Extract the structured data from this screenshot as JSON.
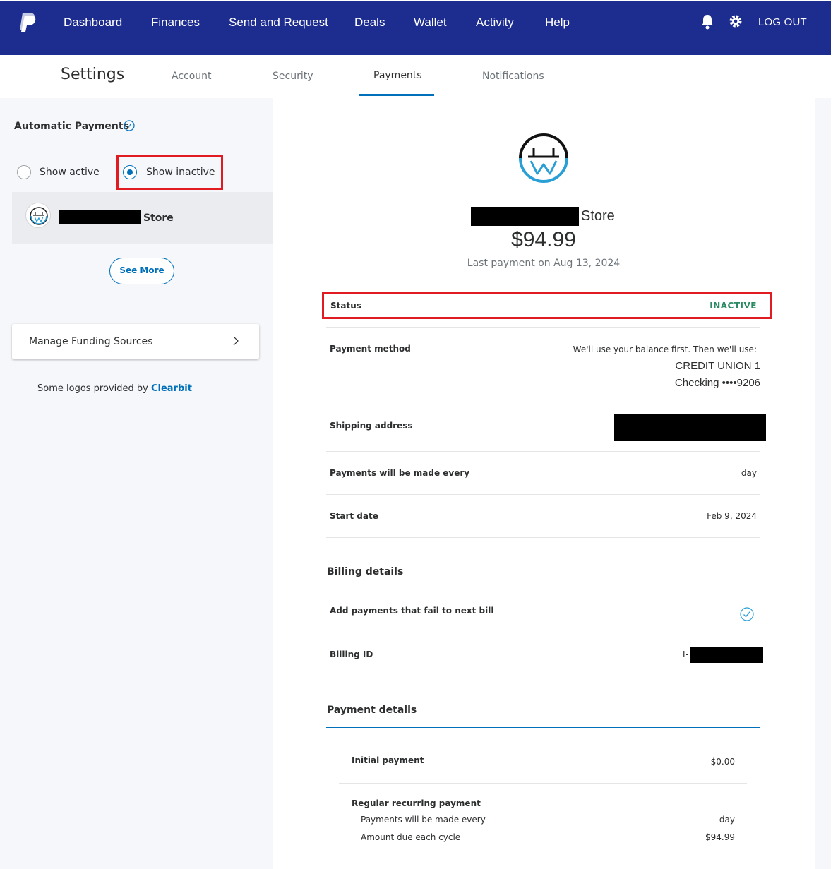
{
  "nav": {
    "items": [
      "Dashboard",
      "Finances",
      "Send and Request",
      "Deals",
      "Wallet",
      "Activity",
      "Help"
    ],
    "logout": "LOG OUT"
  },
  "subnav": {
    "title": "Settings",
    "tabs": [
      "Account",
      "Security",
      "Payments",
      "Notifications"
    ],
    "active_tab": "Payments"
  },
  "left": {
    "title": "Automatic Payments",
    "radio_active": "Show active",
    "radio_inactive": "Show inactive",
    "selected_radio": "Show inactive",
    "merchant_suffix": "Store",
    "see_more": "See More",
    "funding": "Manage Funding Sources",
    "clearbit_prefix": "Some logos provided by",
    "clearbit_link": "Clearbit"
  },
  "detail": {
    "store_suffix": "Store",
    "amount": "$94.99",
    "last_payment": "Last payment on Aug 13, 2024",
    "status_label": "Status",
    "status_value": "INACTIVE",
    "payment_method_label": "Payment method",
    "payment_method_note": "We'll use your balance first. Then we'll use:",
    "bank_name": "CREDIT UNION 1",
    "bank_account": "Checking ••••9206",
    "shipping_label": "Shipping address",
    "frequency_label": "Payments will be made every",
    "frequency_value": "day",
    "start_label": "Start date",
    "start_value": "Feb 9, 2024",
    "billing_title": "Billing details",
    "add_fail_label": "Add payments that fail to next bill",
    "billing_id_label": "Billing ID",
    "billing_id_prefix": "I-",
    "payment_details_title": "Payment details",
    "initial_label": "Initial payment",
    "initial_value": "$0.00",
    "recurring_label": "Regular recurring payment",
    "recurring_freq_label": "Payments will be made every",
    "recurring_freq_value": "day",
    "amount_due_label": "Amount due each cycle",
    "amount_due_value": "$94.99"
  },
  "colors": {
    "nav_bg": "#1c2c8f",
    "accent": "#0070ba",
    "inactive": "#2a8a63",
    "highlight": "#e11b22"
  }
}
